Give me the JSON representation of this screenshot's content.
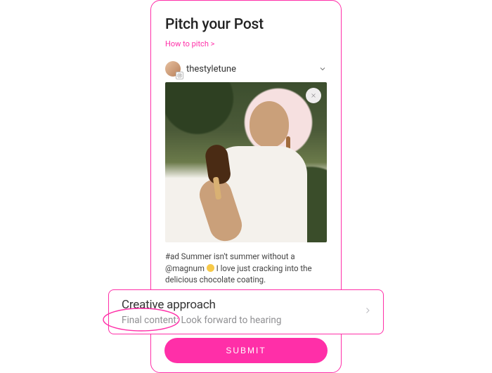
{
  "header": {
    "title": "Pitch your Post",
    "howto_label": "How to pitch >"
  },
  "account": {
    "username": "thestyletune"
  },
  "post": {
    "caption_line1": "#ad Summer isn't summer without a",
    "caption_line2_before_emoji": "@magnum ",
    "caption_line2_after_emoji": " I love just cracking into the",
    "caption_line3": "delicious chocolate coating."
  },
  "overlay": {
    "title": "Creative approach",
    "subtitle": "Final content: Look forward to hearing"
  },
  "submit": {
    "label": "SUBMIT"
  }
}
